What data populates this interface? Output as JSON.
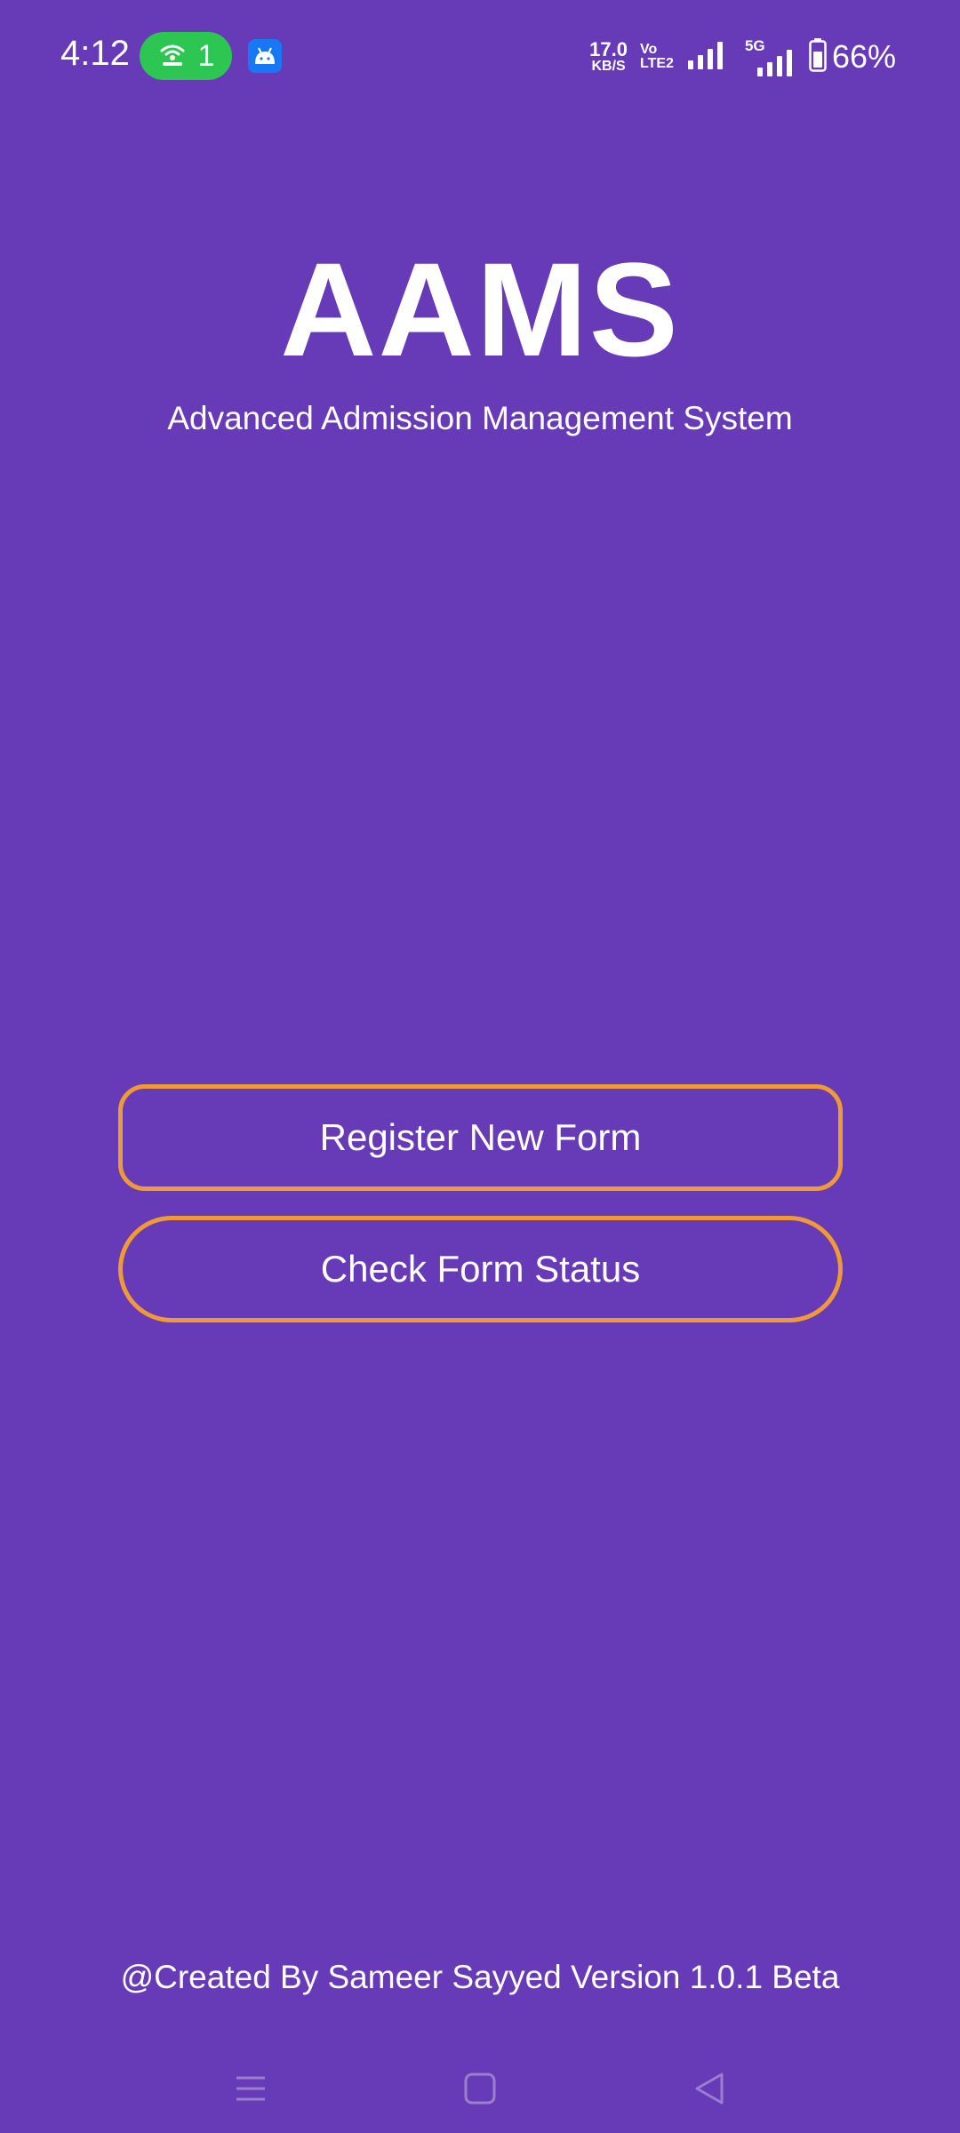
{
  "status_bar": {
    "time": "4:12",
    "hotspot_count": "1",
    "net_speed_value": "17.0",
    "net_speed_unit": "KB/S",
    "volte_top": "Vo",
    "volte_bottom": "LTE2",
    "network_type": "5G",
    "battery": "66%"
  },
  "header": {
    "title": "AAMS",
    "subtitle": "Advanced Admission Management System"
  },
  "actions": {
    "register_label": "Register New Form",
    "status_label": "Check Form Status"
  },
  "footer": {
    "credit": "@Created By Sameer Sayyed Version 1.0.1 Beta"
  },
  "colors": {
    "background": "#673AB7",
    "button_border": "#F09A37",
    "hotspot_pill": "#2DC653",
    "notification_app": "#1877F2",
    "text": "#FFFFFF"
  },
  "icons": {
    "hotspot": "hotspot-icon",
    "notification": "android-app-icon",
    "signal": "signal-icon",
    "battery": "battery-icon",
    "nav_menu": "menu-icon",
    "nav_home": "home-icon",
    "nav_back": "back-icon"
  }
}
